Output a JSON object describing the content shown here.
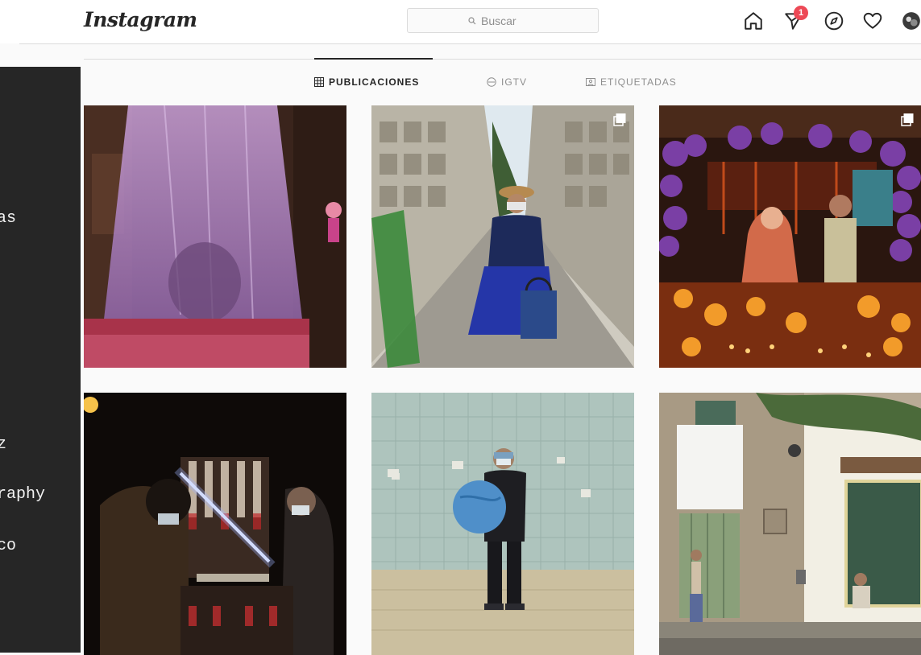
{
  "nav": {
    "logo": "Instagram",
    "search_placeholder": "Buscar",
    "notification_count": "1"
  },
  "tabs": [
    {
      "label": "PUBLICACIONES",
      "icon": "grid-icon",
      "active": true
    },
    {
      "label": "IGTV",
      "icon": "igtv-icon",
      "active": false
    },
    {
      "label": "ETIQUETADAS",
      "icon": "tagged-icon",
      "active": false
    }
  ],
  "side_panel": {
    "texts": [
      "as",
      "z",
      "raphy",
      "co"
    ]
  },
  "posts": [
    {
      "subject": "purple-mosquito-net-bedroom",
      "multiple": false
    },
    {
      "subject": "cemetery-woman-blue-skirt",
      "multiple": true
    },
    {
      "subject": "day-of-dead-altar-purple-balloons",
      "multiple": true
    },
    {
      "subject": "night-market-light-beam",
      "multiple": false
    },
    {
      "subject": "person-holding-globe-tiled-wall",
      "multiple": false
    },
    {
      "subject": "colonial-street-white-cloth",
      "multiple": false
    }
  ],
  "colors": {
    "accent_badge": "#ed4956",
    "text_primary": "#262626",
    "text_secondary": "#8e8e8e",
    "side_panel_bg": "#262626"
  }
}
